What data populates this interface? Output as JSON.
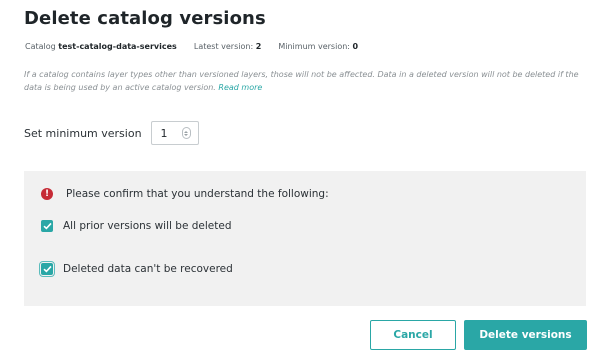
{
  "dialog": {
    "title": "Delete catalog versions",
    "catalog_label": "Catalog",
    "catalog_value": "test-catalog-data-services",
    "latest_label": "Latest version:",
    "latest_value": "2",
    "minimum_label": "Minimum version:",
    "minimum_value": "0",
    "note_text": "If a catalog contains layer types other than versioned layers, those will not be affected. Data in a deleted version will not be deleted if the data is being used by an active catalog version.",
    "note_link": "Read more"
  },
  "min_version": {
    "label": "Set minimum version",
    "value": "1"
  },
  "confirm": {
    "heading": "Please confirm that you understand the following:",
    "items": [
      {
        "label": "All prior versions will be deleted",
        "checked": true
      },
      {
        "label": "Deleted data can't be recovered",
        "checked": true
      }
    ]
  },
  "buttons": {
    "cancel": "Cancel",
    "delete": "Delete versions"
  },
  "colors": {
    "accent": "#2aa7a6",
    "warning": "#c62b36",
    "panel_bg": "#f1f1f1"
  },
  "icons": {
    "warning": "warning-icon",
    "check": "checkmark-icon",
    "spinner": "stepper-arrows-icon"
  }
}
